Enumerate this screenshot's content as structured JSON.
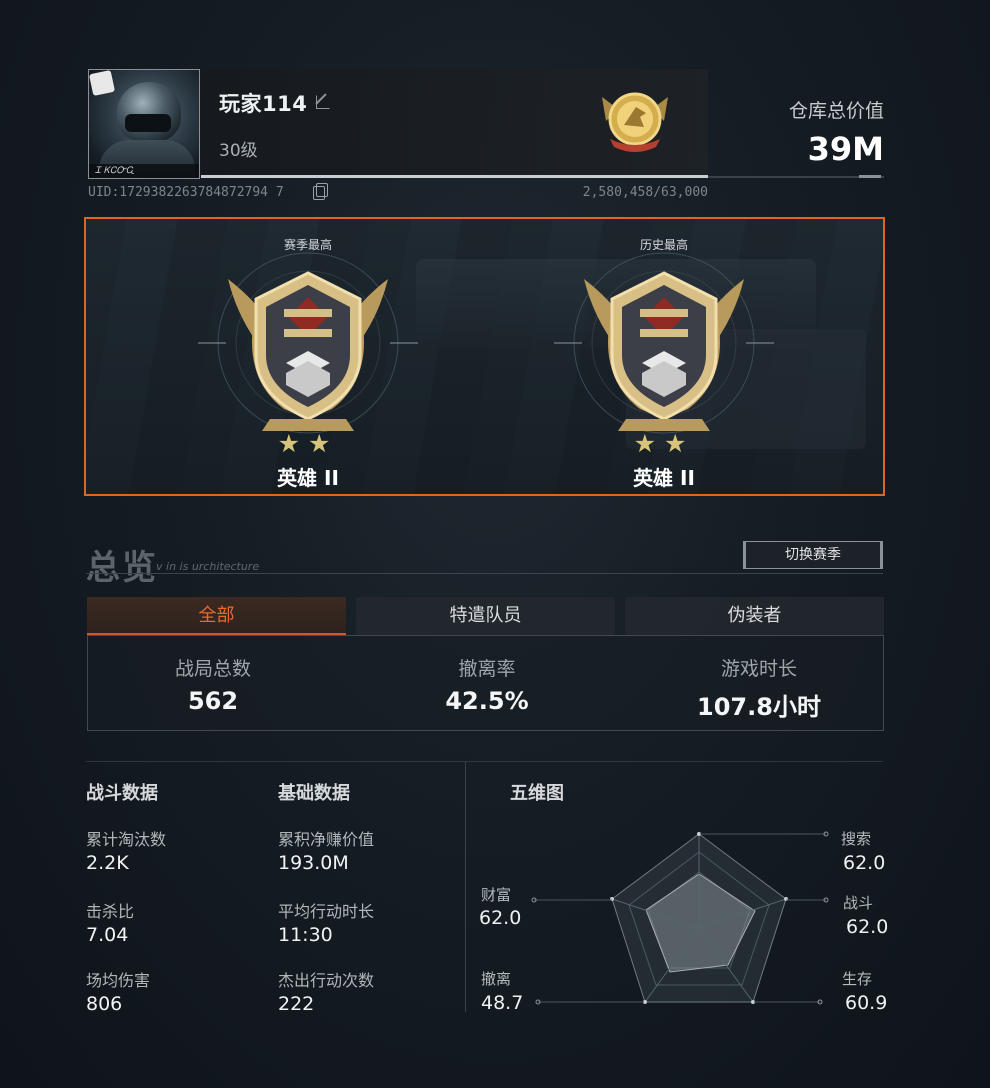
{
  "player": {
    "name": "玩家114",
    "level": "30级",
    "uid": "UID:1729382263784872794 7",
    "uid_text": "UID:1729382263784872794 7",
    "exp": "2,580,458/63,000",
    "avatar_caption": "Ꮖ ᏦᏟᏅᏩ"
  },
  "warehouse": {
    "label": "仓库总价值",
    "value": "39M"
  },
  "ranks": {
    "season": {
      "caption": "赛季最高",
      "stars": "★★",
      "title": "英雄 II"
    },
    "history": {
      "caption": "历史最高",
      "stars": "★★",
      "title": "英雄 II"
    }
  },
  "overview": {
    "title": "总览",
    "subtitle": "v in is urchitecture",
    "switch_label": "切换赛季",
    "tabs": [
      "全部",
      "特遣队员",
      "伪装者"
    ],
    "summary": [
      {
        "label": "战局总数",
        "value": "562"
      },
      {
        "label": "撤离率",
        "value": "42.5%"
      },
      {
        "label": "游戏时长",
        "value": "107.8小时"
      }
    ]
  },
  "combat": {
    "title": "战斗数据",
    "items": [
      {
        "label": "累计淘汰数",
        "value": "2.2K"
      },
      {
        "label": "击杀比",
        "value": "7.04"
      },
      {
        "label": "场均伤害",
        "value": "806"
      }
    ]
  },
  "basic": {
    "title": "基础数据",
    "items": [
      {
        "label": "累积净赚价值",
        "value": "193.0M"
      },
      {
        "label": "平均行动时长",
        "value": "11:30"
      },
      {
        "label": "杰出行动次数",
        "value": "222"
      }
    ]
  },
  "radar": {
    "title": "五维图",
    "axes": [
      {
        "label": "搜索",
        "value": "62.0"
      },
      {
        "label": "战斗",
        "value": "62.0"
      },
      {
        "label": "生存",
        "value": "60.9"
      },
      {
        "label": "撤离",
        "value": "48.7"
      },
      {
        "label": "财富",
        "value": "62.0"
      }
    ]
  },
  "colors": {
    "accent": "#e0661f",
    "gold": "#c8a45a"
  }
}
